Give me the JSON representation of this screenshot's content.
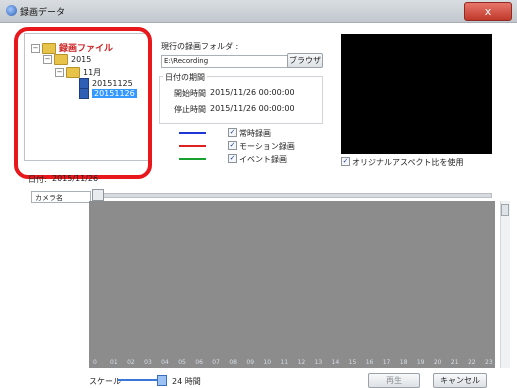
{
  "window": {
    "title": "録画データ",
    "close_label": "x"
  },
  "tree": {
    "root": "録画ファイル",
    "year": "2015",
    "month": "11月",
    "days": [
      "20151125",
      "20151126"
    ],
    "selected": "20151126"
  },
  "folder": {
    "label": "現行の録画フォルダ :",
    "value": "E:\\Recording",
    "browse_label": "ブラウザ"
  },
  "time_range": {
    "group_label": "日付の期間",
    "start_label": "開始時間",
    "start_value": "2015/11/26 00:00:00",
    "stop_label": "停止時間",
    "stop_value": "2015/11/26 00:00:00"
  },
  "legend": [
    {
      "label": "常時録画",
      "color": "#1f35d6",
      "checked": true
    },
    {
      "label": "モーション録画",
      "color": "#e02020",
      "checked": true
    },
    {
      "label": "イベント録画",
      "color": "#18a030",
      "checked": true
    }
  ],
  "aspect": {
    "label": "オリジナルアスペクト比を使用",
    "checked": true
  },
  "date": {
    "label": "日付:",
    "value": "2015/11/26"
  },
  "camera": {
    "label": "カメラ名"
  },
  "timeline": {
    "hours": [
      "0",
      "01",
      "02",
      "03",
      "04",
      "05",
      "06",
      "07",
      "08",
      "09",
      "10",
      "11",
      "12",
      "13",
      "14",
      "15",
      "16",
      "17",
      "18",
      "19",
      "20",
      "21",
      "22",
      "23"
    ]
  },
  "scale": {
    "label": "スケール",
    "value": "24 時間"
  },
  "buttons": {
    "play": "再生",
    "cancel": "キャンセル"
  },
  "colors": {
    "highlight": "#e8171b",
    "video_bg": "#000000",
    "timeline_bg": "#8c8c8c"
  }
}
